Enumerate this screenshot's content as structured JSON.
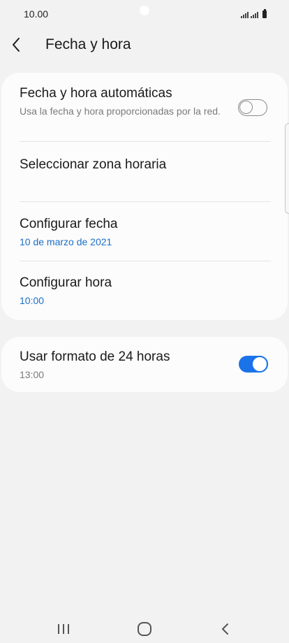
{
  "status_bar": {
    "time": "10.00"
  },
  "header": {
    "title": "Fecha y hora"
  },
  "settings": {
    "auto_datetime": {
      "title": "Fecha y hora automáticas",
      "subtitle": "Usa la fecha y hora proporcionadas por la red.",
      "enabled": false
    },
    "timezone": {
      "title": "Seleccionar zona horaria"
    },
    "set_date": {
      "title": "Configurar fecha",
      "value": "10 de marzo de 2021"
    },
    "set_time": {
      "title": "Configurar hora",
      "value": "10:00"
    },
    "format_24h": {
      "title": "Usar formato de 24 horas",
      "value": "13:00",
      "enabled": true
    }
  },
  "colors": {
    "accent": "#1a73e8",
    "value_text": "#1b6fc6",
    "background": "#f2f2f2",
    "card": "#fcfcfc"
  },
  "icons": {
    "back": "chevron-left-icon",
    "recents": "recent-apps-icon",
    "home": "home-icon",
    "nav_back": "nav-back-icon"
  }
}
